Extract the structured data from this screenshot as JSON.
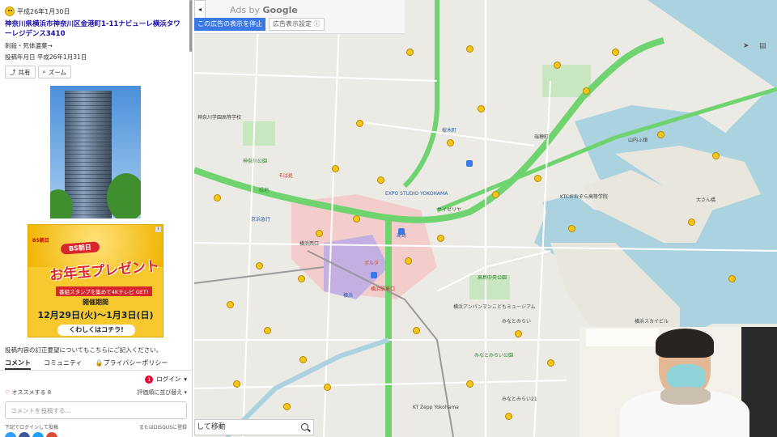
{
  "post": {
    "date": "平成26年1月30日",
    "title": "神奈川県横浜市神奈川区金港町1-11ナビューレ横浜タワーレジデンス3410",
    "category": "刺殺・死体遺棄→",
    "posted": "投稿年月日 平成26年1月31日",
    "share_label": "共有",
    "zoom_label": "ズーム"
  },
  "ad_banner": {
    "logo": "BS朝日",
    "headline_top": "BS朝日",
    "headline_main": "お年玉プレゼント",
    "sub": "番組スタンプを集めて4Kテレビ GET!",
    "period_label": "開催期間",
    "dates": "12月29日(火)～1月3日(日)",
    "cta": "くわしくはコチラ!"
  },
  "comments": {
    "notice": "投稿内容の訂正要望についてもこちらにご記入ください。",
    "tabs": [
      "コメント",
      "コミュニティ",
      "プライバシーポリシー"
    ],
    "badge": "1",
    "login": "ログイン",
    "recommend": "オススメする",
    "recommend_count": "8",
    "sort": "評価順に並び替え",
    "placeholder": "コメントを投稿する...",
    "login_hint_left": "下記でログインして投稿",
    "login_hint_right": "またはDISQUSに登録"
  },
  "map": {
    "ads_by": "Ads by",
    "google": "Google",
    "stop_ad": "この広告の表示を停止",
    "ad_settings": "広告表示設定 ⓘ",
    "collapse": "◂",
    "search_text": "して移動",
    "labels": {
      "sakuragi": "桜木町",
      "yokohama": "横浜",
      "takashima": "高島",
      "minatomirai": "みなとみらい",
      "osanbashi": "大さん橋",
      "kanagawa_park": "神奈川公園",
      "expo": "EXPO STUDIO YOKOHAMA",
      "yokohama_station_east": "横浜駅東口",
      "sky": "横浜スカイビル",
      "ktc": "KTCおおぞら高等学院",
      "green_park": "高島中央公園",
      "anpanman": "横浜アンパンマンこどもミュージアム",
      "minatomirai21": "みなとみらい21",
      "mm_park": "みなとみらい公園",
      "zepp": "KT Zepp Yokohama",
      "porta": "ポルタ",
      "sainte": "サイゼリヤ",
      "mizuho": "瑞穂町",
      "keihin": "京浜急行",
      "kanagawa_gakuen": "神奈川学園高等学校",
      "yokohama_red": "そば処",
      "yokohama_west": "横浜西口",
      "ryokuchi": "緑地",
      "yamanouchi": "山内ふ頭"
    }
  },
  "colors": {
    "road_green": "#6fd46f",
    "water": "#aad3df",
    "highlight": "#f5c6c6",
    "station": "#b6a8e6",
    "pin": "#f5c518"
  }
}
